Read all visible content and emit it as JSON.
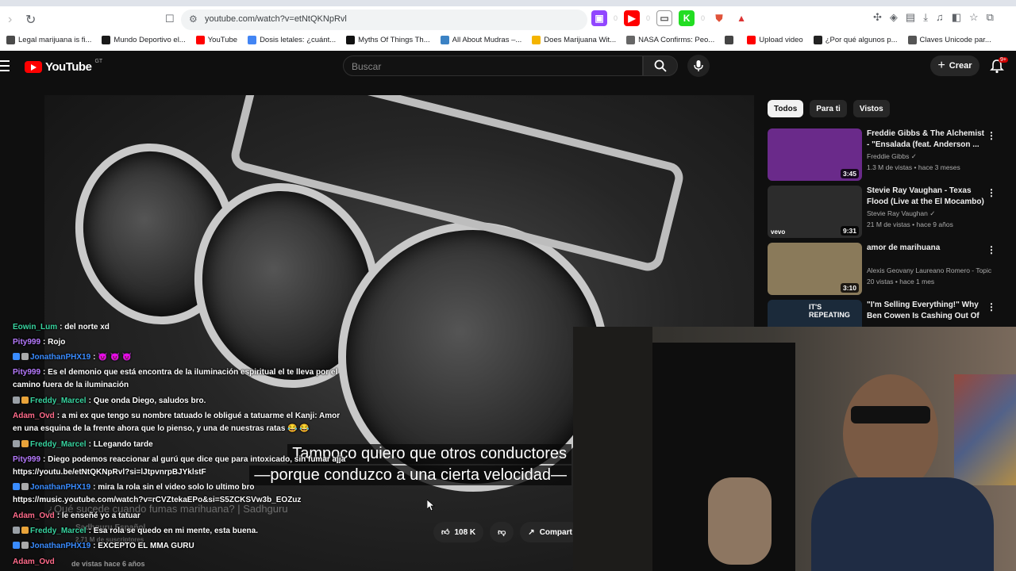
{
  "browser": {
    "url": "youtube.com/watch?v=etNtQKNpRvl",
    "extension_badges": [
      "0",
      "0",
      "0"
    ],
    "bookmarks": [
      {
        "label": "Legal marijuana is fi...",
        "color": "#4a4a4a"
      },
      {
        "label": "Mundo Deportivo el...",
        "color": "#1a1a1a"
      },
      {
        "label": "YouTube",
        "color": "#ff0000"
      },
      {
        "label": "Dosis letales: ¿cuánt...",
        "color": "#4285f4"
      },
      {
        "label": "Myths Of Things Th...",
        "color": "#111111"
      },
      {
        "label": "All About Mudras –...",
        "color": "#3b82c4"
      },
      {
        "label": "Does Marijuana Wit...",
        "color": "#f4b400"
      },
      {
        "label": "NASA Confirms: Peo...",
        "color": "#666666"
      },
      {
        "label": "",
        "color": "#444444"
      },
      {
        "label": "Upload video",
        "color": "#ff0000"
      },
      {
        "label": "¿Por qué algunos p...",
        "color": "#222222"
      },
      {
        "label": "Claves Unicode par...",
        "color": "#555555"
      }
    ]
  },
  "header": {
    "logo_text": "YouTube",
    "logo_country": "GT",
    "search_placeholder": "Buscar",
    "create_label": "Crear",
    "notifications_badge": "9+"
  },
  "chips": [
    "Todos",
    "Para ti",
    "Vistos"
  ],
  "recommendations": [
    {
      "title": "Freddie Gibbs & The Alchemist - \"Ensalada (feat. Anderson ...",
      "channel": "Freddie Gibbs",
      "verified": true,
      "meta": "1.3 M de vistas • hace 3 meses",
      "duration": "3:45",
      "thumb_bg": "#6a2a8a"
    },
    {
      "title": "Stevie Ray Vaughan - Texas Flood (Live at the El Mocambo)",
      "channel": "Stevie Ray Vaughan",
      "verified": true,
      "meta": "21 M de vistas • hace 9 años",
      "duration": "9:31",
      "thumb_bg": "#2c2c2c",
      "thumb_label": "vevo"
    },
    {
      "title": "amor de marihuana",
      "channel": "Alexis Geovany Laureano Romero - Topic",
      "verified": false,
      "meta": "20 vistas • hace 1 mes",
      "duration": "3:10",
      "thumb_bg": "#8a7a5a"
    },
    {
      "title": "\"I'm Selling Everything!\" Why Ben Cowen Is Cashing Out Of ...",
      "channel": "",
      "verified": false,
      "meta": "",
      "duration": "",
      "thumb_bg": "#1b2a3a",
      "thumb_label": "IT'S REPEATING"
    }
  ],
  "chat": [
    {
      "user": "Eowin_Lum",
      "user_color": "#38d39f",
      "text": "del norte xd",
      "badges": []
    },
    {
      "user": "Pity999",
      "user_color": "#b77bff",
      "text": "Rojo",
      "badges": []
    },
    {
      "user": "JonathanPHX19",
      "user_color": "#3a8cff",
      "text": "😈 😈 😈",
      "badges": [
        "#3a8cff",
        "#aaaaaa"
      ]
    },
    {
      "user": "Pity999",
      "user_color": "#b77bff",
      "text": "Es el demonio que está encontra de la iluminación espiritual el te lleva por el camino fuera de la iluminación",
      "badges": []
    },
    {
      "user": "Freddy_Marcel",
      "user_color": "#38d39f",
      "text": "Que onda Diego, saludos bro.",
      "badges": [
        "#9aa0a6",
        "#e8a33a"
      ]
    },
    {
      "user": "Adam_Ovd",
      "user_color": "#ff6b8a",
      "text": "a mi ex que tengo su nombre tatuado le obligué a tatuarme el Kanji: Amor en una esquina de la frente ahora que lo pienso, y una de nuestras ratas 😂 😂",
      "badges": []
    },
    {
      "user": "Freddy_Marcel",
      "user_color": "#38d39f",
      "text": "LLegando tarde",
      "badges": [
        "#9aa0a6",
        "#e8a33a"
      ]
    },
    {
      "user": "Pity999",
      "user_color": "#b77bff",
      "text": "Diego podemos reaccionar al gurú que dice que para intoxicado, sin fumar ajja https://youtu.be/etNtQKNpRvl?si=lJtpvnrpBJYklstF",
      "badges": []
    },
    {
      "user": "JonathanPHX19",
      "user_color": "#3a8cff",
      "text": "mira la rola sin el video solo lo ultimo bro https://music.youtube.com/watch?v=rCVZtekaEPo&si=S5ZCKSVw3b_EOZuz",
      "badges": [
        "#3a8cff",
        "#aaaaaa"
      ]
    },
    {
      "user": "Adam_Ovd",
      "user_color": "#ff6b8a",
      "text": "le enseñé yo a tatuar",
      "badges": []
    },
    {
      "user": "Freddy_Marcel",
      "user_color": "#38d39f",
      "text": "Esa rola se quedo en mi mente, esta buena.",
      "badges": [
        "#9aa0a6",
        "#e8a33a"
      ]
    },
    {
      "user": "JonathanPHX19",
      "user_color": "#3a8cff",
      "text": "EXCEPTO EL MMA GURU",
      "badges": [
        "#3a8cff",
        "#aaaaaa"
      ]
    },
    {
      "user": "Adam_Ovd",
      "user_color": "#ff6b8a",
      "text": "",
      "badges": []
    }
  ],
  "captions": [
    "Tampoco quiero que otros conductores",
    "—porque conduzco a una cierta velocidad—"
  ],
  "video": {
    "title_behind": "¿Qué sucede cuando fumas marihuana? | Sadhguru",
    "channel_behind": "Sadhguru Español",
    "subs_behind": "2.71 M de suscriptores",
    "views_behind": "de vistas  hace 6 años",
    "likes": "108 K",
    "share_label": "Compart"
  }
}
